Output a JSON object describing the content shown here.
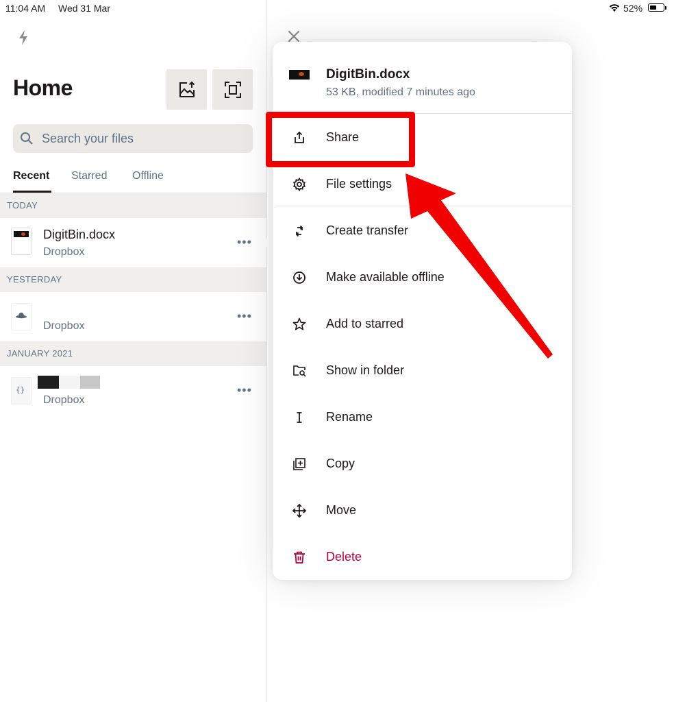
{
  "status_bar": {
    "time": "11:04 AM",
    "date": "Wed 31 Mar",
    "battery": "52%"
  },
  "left_pane": {
    "title": "Home",
    "search_placeholder": "Search your files",
    "tabs": [
      {
        "label": "Recent",
        "active": true
      },
      {
        "label": "Starred",
        "active": false
      },
      {
        "label": "Offline",
        "active": false
      }
    ],
    "sections": [
      {
        "header": "TODAY",
        "files": [
          {
            "name": "DigitBin.docx",
            "location": "Dropbox"
          }
        ]
      },
      {
        "header": "YESTERDAY",
        "files": [
          {
            "name": "",
            "location": "Dropbox"
          }
        ]
      },
      {
        "header": "JANUARY 2021",
        "files": [
          {
            "name": "",
            "location": "Dropbox"
          }
        ]
      }
    ],
    "more_label": "•••"
  },
  "menu": {
    "file_name": "DigitBin.docx",
    "file_meta": "53 KB, modified 7 minutes ago",
    "items": [
      {
        "label": "Share",
        "icon": "share-icon"
      },
      {
        "label": "File settings",
        "icon": "gear-icon"
      },
      {
        "label": "Create transfer",
        "icon": "transfer-icon"
      },
      {
        "label": "Make available offline",
        "icon": "offline-download-icon"
      },
      {
        "label": "Add to starred",
        "icon": "star-icon"
      },
      {
        "label": "Show in folder",
        "icon": "folder-search-icon"
      },
      {
        "label": "Rename",
        "icon": "text-cursor-icon"
      },
      {
        "label": "Copy",
        "icon": "copy-icon"
      },
      {
        "label": "Move",
        "icon": "move-icon"
      },
      {
        "label": "Delete",
        "icon": "trash-icon"
      }
    ]
  },
  "colors": {
    "annotation": "#f00000",
    "danger": "#b4003e",
    "muted": "#637282",
    "text": "#1e1919"
  }
}
